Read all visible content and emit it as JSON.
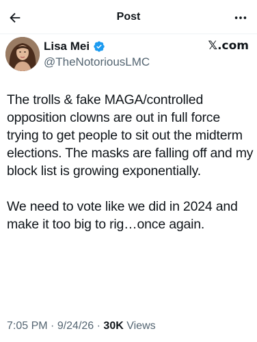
{
  "nav": {
    "title": "Post"
  },
  "author": {
    "display_name": "Lisa Mei",
    "handle": "@TheNotoriousLMC",
    "verified": true,
    "verified_color": "#1d9bf0"
  },
  "source": {
    "label": "𝕏.com"
  },
  "post": {
    "paragraph_1": "The trolls & fake MAGA/controlled opposition clowns are out in full force trying to get people to sit out the midterm elections. The masks are falling off and my block list is growing exponentially.",
    "paragraph_2": "We need to vote like we did in 2024 and make it too big to rig…once again."
  },
  "meta": {
    "time": "7:05 PM",
    "separator_1": " · ",
    "date": "9/24/26",
    "separator_2": " · ",
    "views_count": "30K",
    "views_label": " Views"
  },
  "icons": {
    "back": "back-arrow-icon",
    "more": "more-horizontal-icon",
    "verified": "verified-badge-icon"
  }
}
